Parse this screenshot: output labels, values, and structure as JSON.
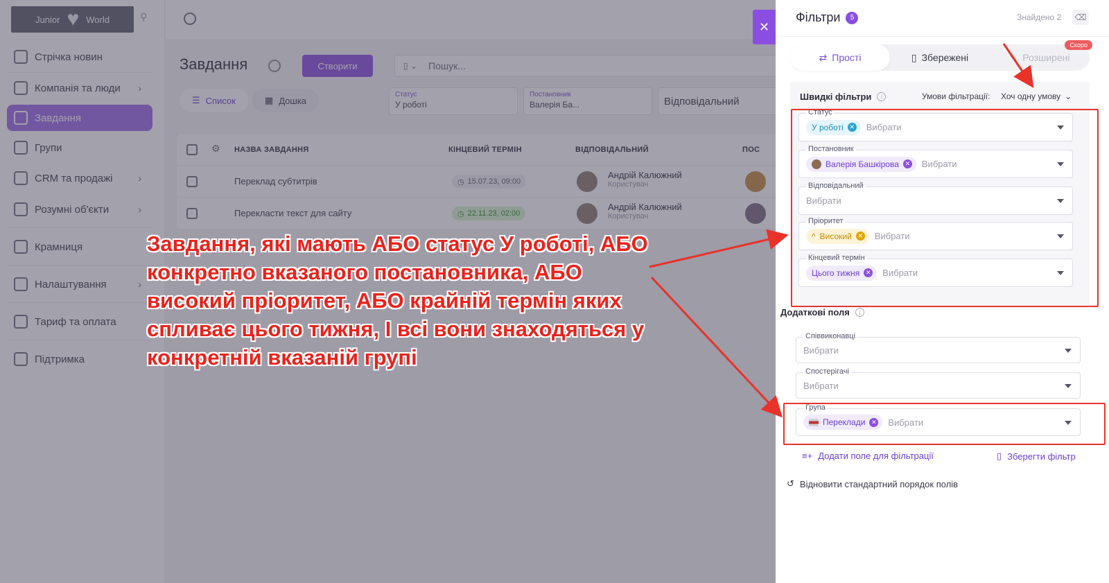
{
  "brand": {
    "name_left": "Junior",
    "name_right": "World"
  },
  "sidebar": {
    "items": [
      {
        "label": "Стрічка новин",
        "icon": "home-icon",
        "chevron": false
      },
      {
        "label": "Компанія та люди",
        "icon": "building-icon",
        "chevron": true
      },
      {
        "label": "Завдання",
        "icon": "calendar-icon",
        "chevron": false,
        "active": true
      },
      {
        "label": "Групи",
        "icon": "users-icon",
        "chevron": false
      },
      {
        "label": "CRM та продажі",
        "icon": "database-icon",
        "chevron": true
      },
      {
        "label": "Розумні об'єкти",
        "icon": "scan-icon",
        "chevron": true
      },
      {
        "label": "Крамниця",
        "icon": "store-icon",
        "chevron": false
      },
      {
        "label": "Налаштування",
        "icon": "gear-icon",
        "chevron": true
      },
      {
        "label": "Тариф та оплата",
        "icon": "wallet-icon",
        "chevron": false
      },
      {
        "label": "Підтримка",
        "icon": "help-icon",
        "chevron": false
      }
    ]
  },
  "main": {
    "title": "Завдання",
    "create_label": "Створити",
    "search_placeholder": "Пошук...",
    "view_tabs": [
      "Список",
      "Дошка"
    ],
    "filters": [
      {
        "label": "Статус",
        "value": "У роботі"
      },
      {
        "label": "Постановник",
        "value": "Валерія Ба..."
      },
      {
        "label": "",
        "value": "Відповідальний"
      }
    ],
    "columns": [
      "НАЗВА ЗАВДАННЯ",
      "КІНЦЕВИЙ ТЕРМІН",
      "ВІДПОВІДАЛЬНИЙ",
      "ПОС"
    ],
    "rows": [
      {
        "name": "Переклад субтитрів",
        "deadline": "15.07.23, 09:00",
        "overdue": false,
        "assignee": "Андрій Калюжний",
        "role": "Користувач"
      },
      {
        "name": "Перекласти текст для сайту",
        "deadline": "22.11.23, 02:00",
        "overdue": true,
        "assignee": "Андрій Калюжний",
        "role": "Користувач"
      }
    ]
  },
  "panel": {
    "title": "Фільтри",
    "count": "5",
    "found": "Знайдено 2",
    "tabs": [
      {
        "label": "Прості",
        "icon": "sliders-icon"
      },
      {
        "label": "Збережені",
        "icon": "bookmark-icon"
      },
      {
        "label": "Розширені",
        "icon": "magic-wand-icon",
        "badge": "Скоро"
      }
    ],
    "quick_title": "Швидкі фільтри",
    "condition_label": "Умови фільтрації:",
    "condition_value": "Хоч одну умову",
    "placeholder": "Вибрати",
    "quick_fields": [
      {
        "legend": "Статус",
        "chip": "У роботі"
      },
      {
        "legend": "Постановник",
        "chip": "Валерія Башкірова"
      },
      {
        "legend": "Відповідальний",
        "chip": ""
      },
      {
        "legend": "Пріоритет",
        "chip": "Високий"
      },
      {
        "legend": "Кінцевий термін",
        "chip": "Цього тижня"
      }
    ],
    "extra_title": "Додаткові поля",
    "extra_fields": [
      {
        "legend": "Співвиконавці",
        "chip": ""
      },
      {
        "legend": "Спостерігачі",
        "chip": ""
      },
      {
        "legend": "Група",
        "chip": "Переклади"
      }
    ],
    "add_field_label": "Додати поле для фільтрації",
    "save_filter_label": "Зберегти фільтр",
    "restore_label": "Відновити стандартний порядок полів"
  },
  "annotation": {
    "lines": [
      "Завдання, які мають АБО статус У роботі, АБО",
      "конкретно вказаного постановника, АБО",
      "високий пріоритет, АБО крайній термін яких",
      "спливає цього тижня, І всі вони знаходяться у",
      "конкретній вказаній групі"
    ]
  },
  "colors": {
    "accent": "#8a4fe0",
    "annotation": "#e8322a"
  }
}
